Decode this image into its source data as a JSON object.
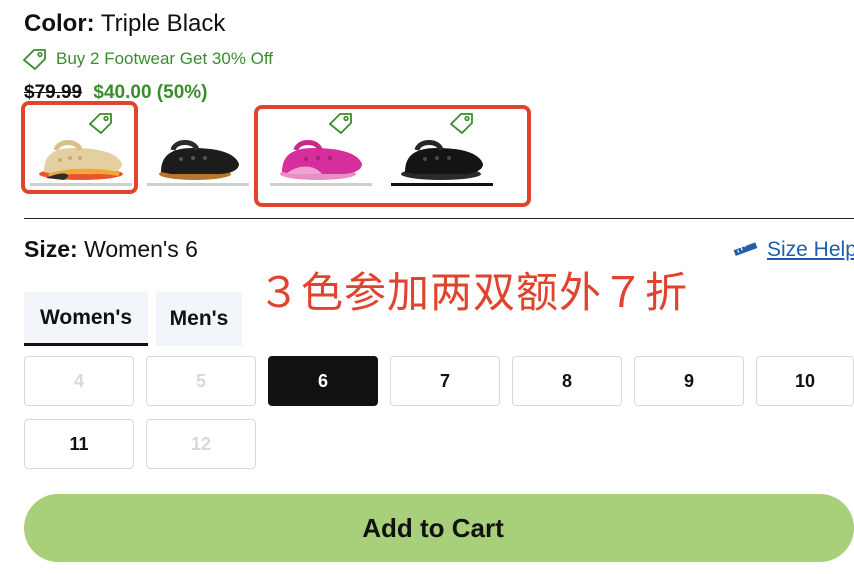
{
  "product": {
    "color_label": "Color:",
    "color_value": "Triple Black",
    "promo_text": "Buy 2 Footwear Get 30% Off",
    "price_original": "$79.99",
    "price_sale": "$40.00 (50%)"
  },
  "swatches": [
    {
      "name": "Bone / Multi",
      "selected": false,
      "promo_tag": true,
      "icon": "clog-icon"
    },
    {
      "name": "Black / Gum",
      "selected": false,
      "promo_tag": false,
      "icon": "clog-icon"
    },
    {
      "name": "Pink",
      "selected": false,
      "promo_tag": true,
      "icon": "clog-icon"
    },
    {
      "name": "Triple Black",
      "selected": true,
      "promo_tag": true,
      "icon": "clog-icon"
    }
  ],
  "size": {
    "label": "Size:",
    "value": "Women's 6",
    "help_link": "Size Help",
    "tabs": [
      {
        "label": "Women's",
        "active": true
      },
      {
        "label": "Men's",
        "active": false
      }
    ],
    "options": [
      {
        "label": "4",
        "state": "disabled"
      },
      {
        "label": "5",
        "state": "disabled"
      },
      {
        "label": "6",
        "state": "selected"
      },
      {
        "label": "7",
        "state": "available"
      },
      {
        "label": "8",
        "state": "available"
      },
      {
        "label": "9",
        "state": "available"
      },
      {
        "label": "10",
        "state": "available"
      },
      {
        "label": "11",
        "state": "available"
      },
      {
        "label": "12",
        "state": "disabled"
      }
    ]
  },
  "annotation": "３色参加两双额外７折",
  "cart_button": "Add to Cart",
  "colors": {
    "promo_green": "#3a8d2c",
    "annotation_red": "#e0432e",
    "cart_green": "#a8d07a",
    "link_blue": "#1f5ea8"
  }
}
